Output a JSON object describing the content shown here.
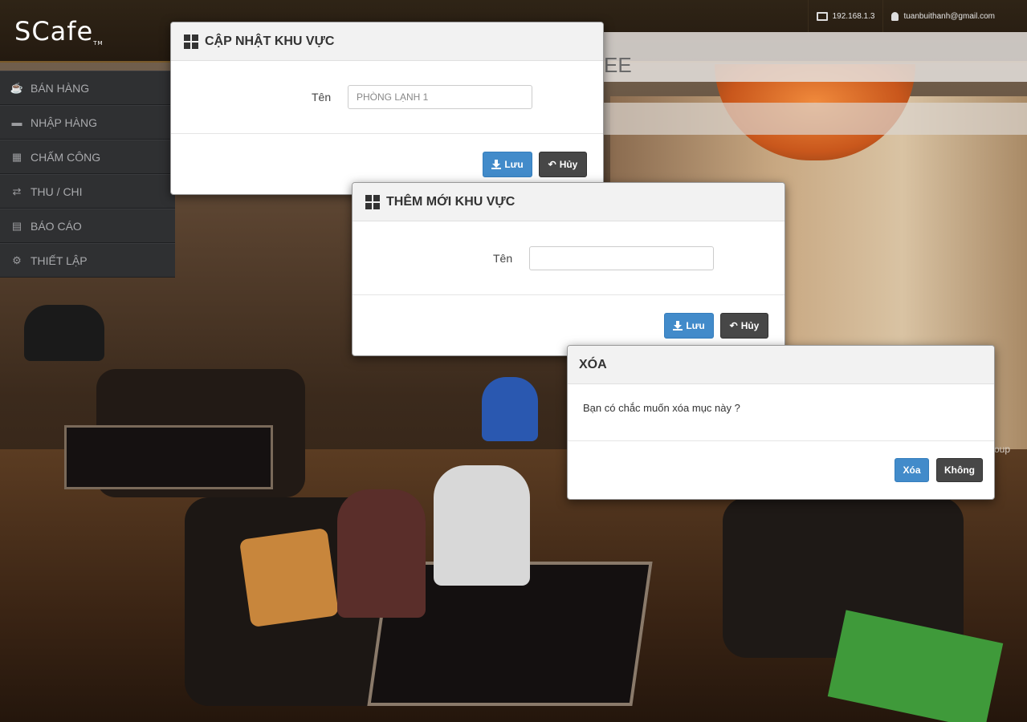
{
  "header": {
    "logo": "Cafe",
    "logo_mark": "S",
    "logo_tm": "TM",
    "ip": "192.168.1.3",
    "user": "tuanbuithanh@gmail.com"
  },
  "background": {
    "subbar_text": "EE",
    "group_fragment": "oup"
  },
  "sidebar": {
    "items": [
      {
        "label": "BÁN HÀNG",
        "icon": "coffee-icon"
      },
      {
        "label": "NHẬP HÀNG",
        "icon": "truck-icon"
      },
      {
        "label": "CHẤM CÔNG",
        "icon": "calendar-icon"
      },
      {
        "label": "THU / CHI",
        "icon": "exchange-icon"
      },
      {
        "label": "BÁO CÁO",
        "icon": "print-icon"
      },
      {
        "label": "THIẾT LẬP",
        "icon": "gears-icon"
      }
    ]
  },
  "modal_update": {
    "title": "CẬP NHẬT KHU VỰC",
    "field_label": "Tên",
    "field_value": "PHÒNG LẠNH 1",
    "save_label": "Lưu",
    "cancel_label": "Hủy"
  },
  "modal_add": {
    "title": "THÊM MỚI KHU VỰC",
    "field_label": "Tên",
    "field_value": "",
    "save_label": "Lưu",
    "cancel_label": "Hủy"
  },
  "modal_delete": {
    "title": "XÓA",
    "message": "Bạn có chắc muốn xóa mục này ?",
    "confirm_label": "Xóa",
    "cancel_label": "Không"
  }
}
